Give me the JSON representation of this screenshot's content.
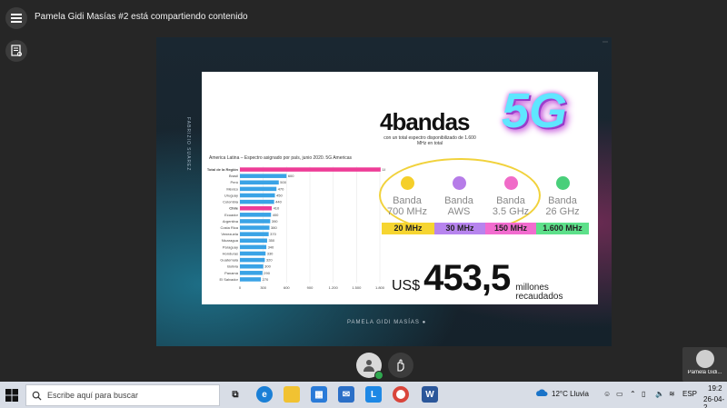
{
  "header": {
    "share_title": "Pamela Gidi Masías #2 está compartiendo contenido"
  },
  "slide": {
    "side_vertical": "FABRIZIO SUAREZ",
    "footer_name": "PAMELA GIDI MASÍAS ●",
    "bands_title": "4bandas",
    "bands_subtitle": "con un total espectro disponibilizado de 1.600 MHz en total",
    "five_g": "5G",
    "bands": [
      {
        "line1": "Banda",
        "line2": "700 MHz",
        "dot": "#f5cf2a"
      },
      {
        "line1": "Banda",
        "line2": "AWS",
        "dot": "#b67ce8"
      },
      {
        "line1": "Banda",
        "line2": "3.5 GHz",
        "dot": "#f06bc8"
      },
      {
        "line1": "Banda",
        "line2": "26 GHz",
        "dot": "#49cf7a"
      }
    ],
    "strips": [
      {
        "label": "20 MHz",
        "color": "#f6d531"
      },
      {
        "label": "30 MHz",
        "color": "#b784ee"
      },
      {
        "label": "150 MHz",
        "color": "#f26ccf"
      },
      {
        "label": "1.600 MHz",
        "color": "#5de08a"
      }
    ],
    "money": {
      "currency": "US$",
      "amount": "453,5",
      "unit_line1": "millones",
      "unit_line2": "recaudados"
    }
  },
  "chart_data": {
    "type": "bar",
    "orientation": "horizontal",
    "title": "America Latina – Espectro asignado por país, junio 2020. 5G Americas",
    "categories": [
      "Total de la Región",
      "Brasil",
      "Perú",
      "México",
      "Uruguay",
      "Colombia",
      "Chile",
      "Ecuador",
      "Argentina",
      "Costa Rica",
      "Venezuela",
      "Nicaragua",
      "Paraguay",
      "Honduras",
      "Guatemala",
      "Bolivia",
      "Panamá",
      "El Salvador"
    ],
    "values": [
      1810,
      600,
      500,
      470,
      450,
      440,
      410,
      400,
      390,
      380,
      370,
      350,
      340,
      330,
      320,
      300,
      290,
      270
    ],
    "highlight": [
      "Total de la Región",
      "Chile"
    ],
    "xlim": [
      0,
      1800
    ],
    "xticks": [
      "0",
      "300",
      "600",
      "900",
      "1.200",
      "1.500",
      "1.800"
    ],
    "colors": {
      "default": "#3aa3e6",
      "highlight": "#ee3c97"
    }
  },
  "controls": {
    "participant_name": "Pamela Gidi..."
  },
  "taskbar": {
    "search_placeholder": "Escribe aquí para buscar",
    "weather": "12°C Lluvia",
    "lang": "ESP",
    "time": "19:2",
    "date": "26-04-2"
  }
}
